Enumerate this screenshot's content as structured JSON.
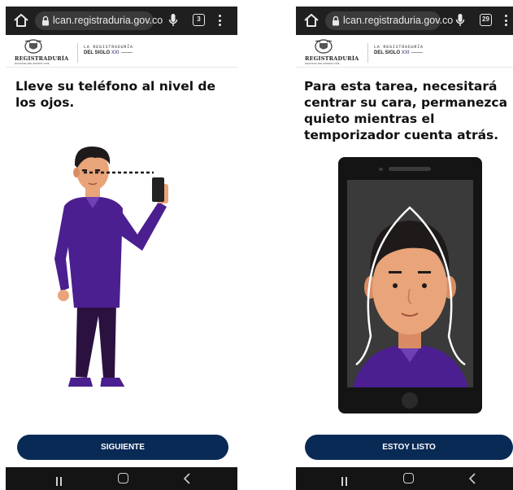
{
  "browser": {
    "url": "lcan.registraduria.gov.co",
    "left_tabs_count": "3",
    "right_tabs_count": "29"
  },
  "brand": {
    "name": "REGISTRADURÍA",
    "subtitle": "NACIONAL DEL ESTADO CIVIL",
    "slogan_line1": "LA REGISTRADURÍA",
    "slogan_line2": "DEL SIGLO",
    "slogan_numeral": "XXI"
  },
  "screens": {
    "left": {
      "instruction": "Lleve su teléfono al nivel de los ojos.",
      "button_label": "SIGUIENTE"
    },
    "right": {
      "instruction": "Para esta tarea, necesitará centrar su cara, permanezca quieto mientras el temporizador cuenta atrás.",
      "button_label": "ESTOY LISTO"
    }
  },
  "icons": [
    "home-icon",
    "lock-icon",
    "mic-icon",
    "tabs-icon",
    "menu-icon",
    "nav-recents-icon",
    "nav-home-icon",
    "nav-back-icon"
  ],
  "colors": {
    "button_bg": "#0a2a56",
    "shirt": "#4b1f8f",
    "pants": "#2b1140",
    "skin": "#e9a47a",
    "hair": "#1e1a1a"
  }
}
